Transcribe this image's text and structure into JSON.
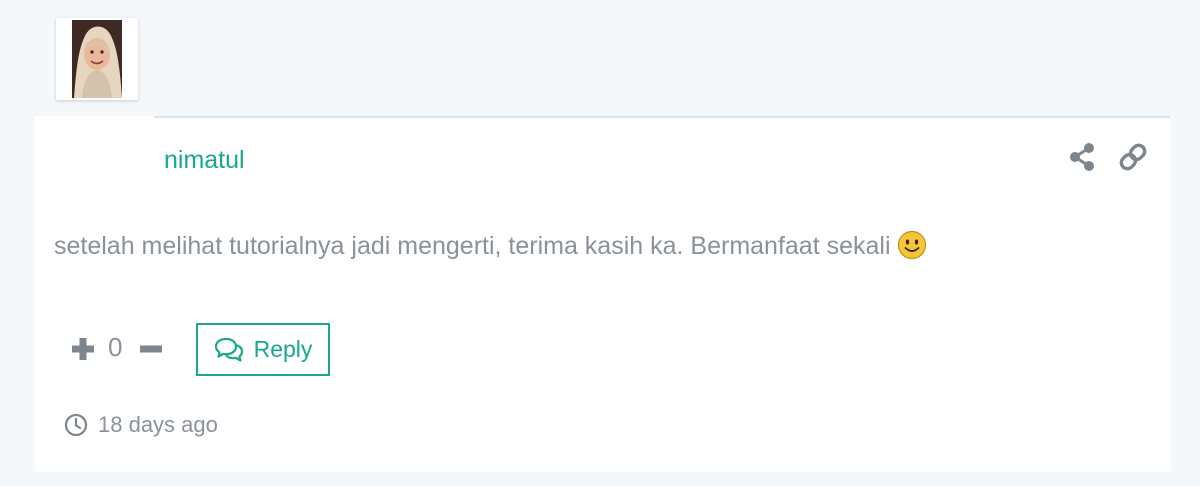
{
  "comment": {
    "author": "nimatul",
    "text": "setelah melihat tutorialnya jadi mengerti, terima kasih ka. Bermanfaat sekali",
    "emoji": "slightly-smiling-face",
    "votes": "0",
    "reply_label": "Reply",
    "timestamp": "18 days ago"
  },
  "icons": {
    "share": "share-icon",
    "permalink": "link-icon",
    "upvote": "plus-icon",
    "downvote": "minus-icon",
    "reply": "speech-bubbles-icon",
    "time": "clock-icon"
  },
  "colors": {
    "accent": "#19a88e",
    "text": "#8a919a",
    "icon": "#7d858d",
    "background": "#f4f8fb",
    "card": "#ffffff"
  }
}
